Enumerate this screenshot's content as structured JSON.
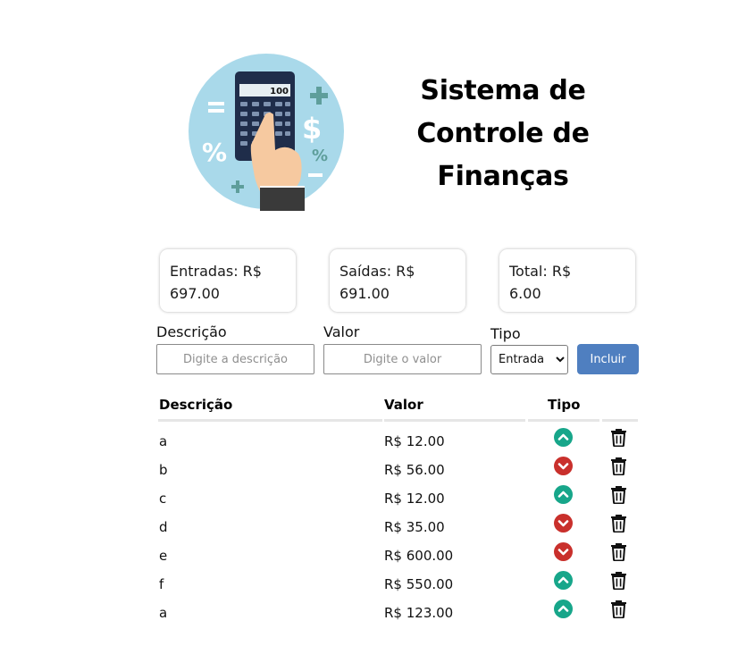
{
  "header": {
    "title_line1": "Sistema de",
    "title_line2": "Controle de",
    "title_line3": "Finanças",
    "calculator_display": "100"
  },
  "summary": {
    "entradas_label": "Entradas: R$",
    "entradas_value": "697.00",
    "saidas_label": "Saídas: R$",
    "saidas_value": "691.00",
    "total_label": "Total: R$",
    "total_value": "6.00"
  },
  "form": {
    "descricao_label": "Descrição",
    "descricao_placeholder": "Digite a descrição",
    "valor_label": "Valor",
    "valor_placeholder": "Digite o valor",
    "tipo_label": "Tipo",
    "tipo_selected": "Entrada",
    "incluir_label": "Incluir"
  },
  "table": {
    "headers": {
      "descricao": "Descrição",
      "valor": "Valor",
      "tipo": "Tipo"
    },
    "rows": [
      {
        "descricao": "a",
        "valor": "R$ 12.00",
        "tipo": "entrada"
      },
      {
        "descricao": "b",
        "valor": "R$ 56.00",
        "tipo": "saida"
      },
      {
        "descricao": "c",
        "valor": "R$ 12.00",
        "tipo": "entrada"
      },
      {
        "descricao": "d",
        "valor": "R$ 35.00",
        "tipo": "saida"
      },
      {
        "descricao": "e",
        "valor": "R$ 600.00",
        "tipo": "saida"
      },
      {
        "descricao": "f",
        "valor": "R$ 550.00",
        "tipo": "entrada"
      },
      {
        "descricao": "a",
        "valor": "R$ 123.00",
        "tipo": "entrada"
      }
    ]
  },
  "icons": {
    "entrada": "chevron-up-circle-icon",
    "saida": "chevron-down-circle-icon",
    "delete": "trash-icon"
  },
  "colors": {
    "entrada": "#17a68a",
    "saida": "#c9302c",
    "button": "#4f7fc0",
    "hero_bg": "#a9d9ea"
  }
}
